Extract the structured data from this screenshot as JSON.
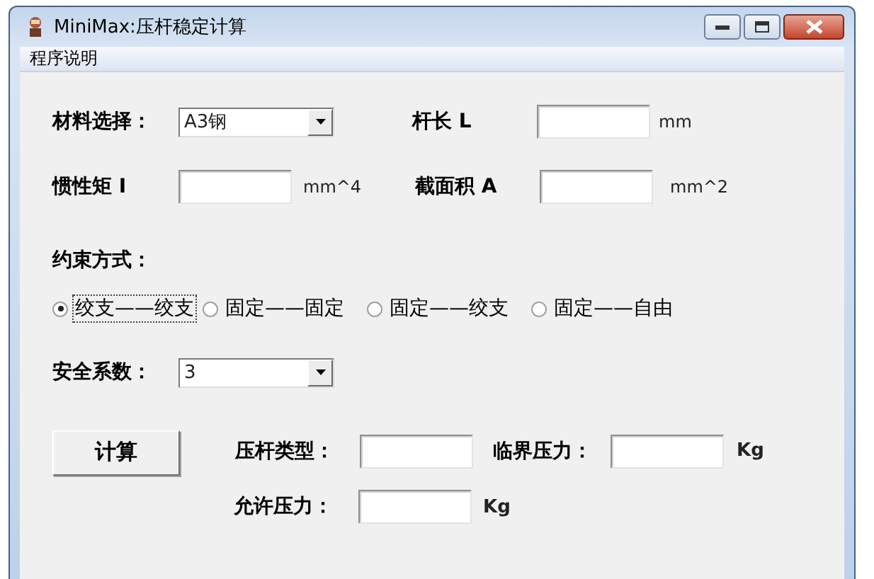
{
  "window": {
    "title": "MiniMax:压杆稳定计算"
  },
  "menu": [
    {
      "label": "程序说明"
    }
  ],
  "form": {
    "material": {
      "label": "材料选择：",
      "value": "A3钢"
    },
    "length": {
      "label": "杆长 L",
      "unit": "mm"
    },
    "inertia": {
      "label": "惯性矩 I",
      "unit": "mm^4"
    },
    "area": {
      "label": "截面积 A",
      "unit": "mm^2"
    },
    "constraint": {
      "label": "约束方式：",
      "options": [
        {
          "label": "绞支——绞支",
          "selected": true,
          "focused": true
        },
        {
          "label": "固定——固定",
          "selected": false,
          "focused": false
        },
        {
          "label": "固定——绞支",
          "selected": false,
          "focused": false
        },
        {
          "label": "固定——自由",
          "selected": false,
          "focused": false
        }
      ]
    },
    "safety": {
      "label": "安全系数：",
      "value": "3"
    },
    "calculate_button": "计算",
    "strut_type": {
      "label": "压杆类型："
    },
    "critical_force": {
      "label": "临界压力：",
      "unit": "Kg"
    },
    "allowable_force": {
      "label": "允许压力：",
      "unit": "Kg"
    }
  }
}
